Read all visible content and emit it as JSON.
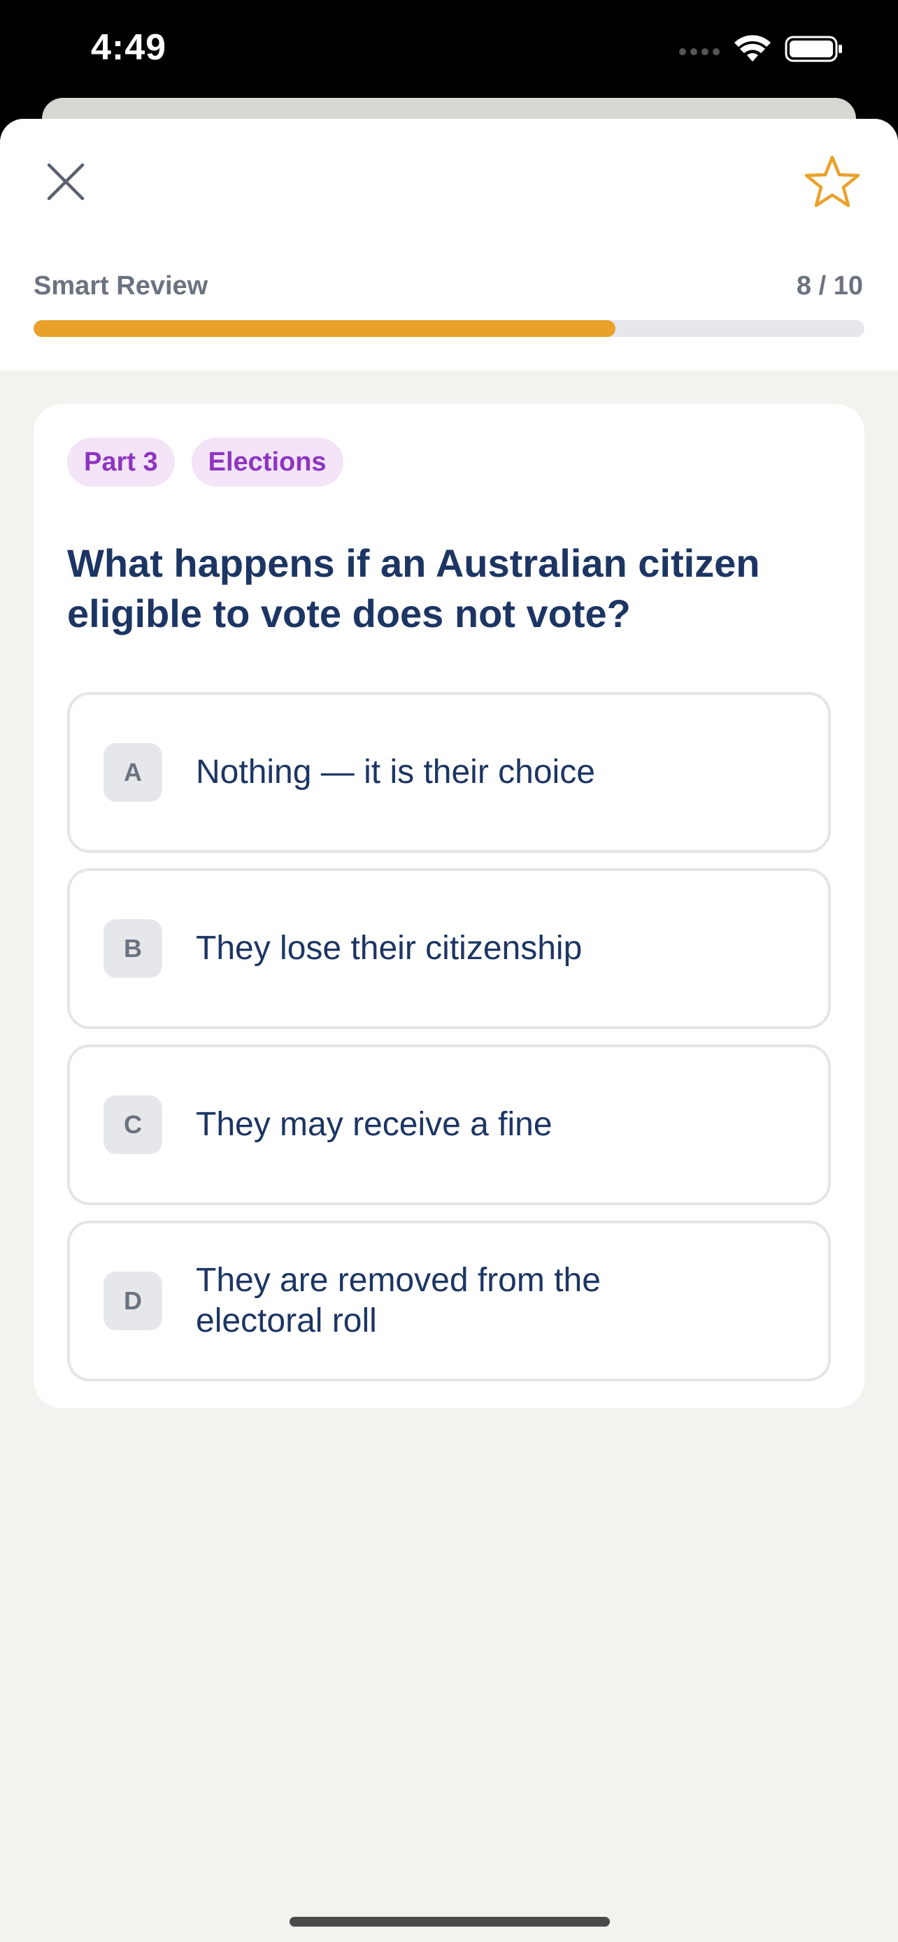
{
  "status_bar": {
    "time": "4:49"
  },
  "header": {
    "progress_label": "Smart Review",
    "progress_count": "8 / 10",
    "progress_fraction": 0.7,
    "accent_color": "#e9a12b",
    "close_icon": "close-icon",
    "favorite_icon": "star-outline-icon"
  },
  "card": {
    "tags": [
      "Part 3",
      "Elections"
    ],
    "question": "What happens if an Australian citizen eligible to vote does not vote?",
    "options": [
      {
        "letter": "A",
        "text": "Nothing — it is their choice"
      },
      {
        "letter": "B",
        "text": "They lose their citizenship"
      },
      {
        "letter": "C",
        "text": "They may receive a fine"
      },
      {
        "letter": "D",
        "text": "They are removed from the electoral roll"
      }
    ]
  }
}
